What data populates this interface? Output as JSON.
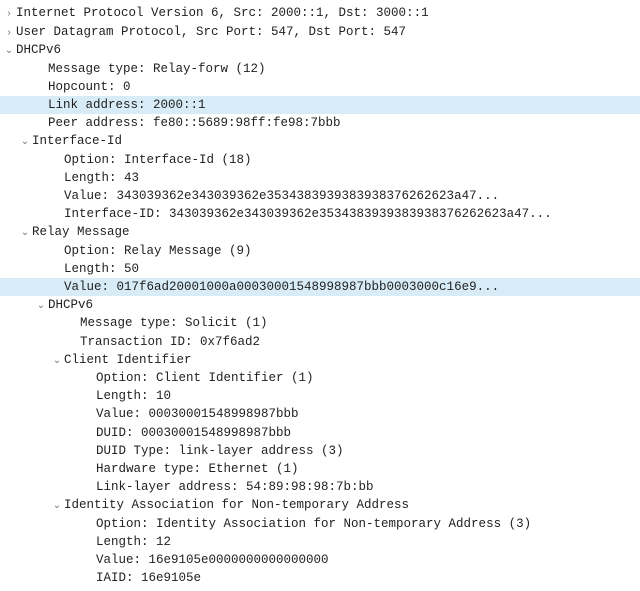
{
  "lines": [
    {
      "indent": 0,
      "caret": "right",
      "hl": false,
      "text": "Internet Protocol Version 6, Src: 2000::1, Dst: 3000::1"
    },
    {
      "indent": 0,
      "caret": "right",
      "hl": false,
      "text": "User Datagram Protocol, Src Port: 547, Dst Port: 547"
    },
    {
      "indent": 0,
      "caret": "down",
      "hl": false,
      "text": "DHCPv6"
    },
    {
      "indent": 2,
      "caret": "none",
      "hl": false,
      "text": "Message type: Relay-forw (12)"
    },
    {
      "indent": 2,
      "caret": "none",
      "hl": false,
      "text": "Hopcount: 0"
    },
    {
      "indent": 2,
      "caret": "none",
      "hl": true,
      "text": "Link address: 2000::1"
    },
    {
      "indent": 2,
      "caret": "none",
      "hl": false,
      "text": "Peer address: fe80::5689:98ff:fe98:7bbb"
    },
    {
      "indent": 1,
      "caret": "down",
      "hl": false,
      "text": "Interface-Id"
    },
    {
      "indent": 3,
      "caret": "none",
      "hl": false,
      "text": "Option: Interface-Id (18)"
    },
    {
      "indent": 3,
      "caret": "none",
      "hl": false,
      "text": "Length: 43"
    },
    {
      "indent": 3,
      "caret": "none",
      "hl": false,
      "text": "Value: 343039362e343039362e3534383939383938376262623a47..."
    },
    {
      "indent": 3,
      "caret": "none",
      "hl": false,
      "text": "Interface-ID: 343039362e343039362e3534383939383938376262623a47..."
    },
    {
      "indent": 1,
      "caret": "down",
      "hl": false,
      "text": "Relay Message"
    },
    {
      "indent": 3,
      "caret": "none",
      "hl": false,
      "text": "Option: Relay Message (9)"
    },
    {
      "indent": 3,
      "caret": "none",
      "hl": false,
      "text": "Length: 50"
    },
    {
      "indent": 3,
      "caret": "none",
      "hl": true,
      "text": "Value: 017f6ad20001000a00030001548998987bbb0003000c16e9..."
    },
    {
      "indent": 2,
      "caret": "down",
      "hl": false,
      "text": "DHCPv6"
    },
    {
      "indent": 4,
      "caret": "none",
      "hl": false,
      "text": "Message type: Solicit (1)"
    },
    {
      "indent": 4,
      "caret": "none",
      "hl": false,
      "text": "Transaction ID: 0x7f6ad2"
    },
    {
      "indent": 3,
      "caret": "down",
      "hl": false,
      "text": "Client Identifier"
    },
    {
      "indent": 5,
      "caret": "none",
      "hl": false,
      "text": "Option: Client Identifier (1)"
    },
    {
      "indent": 5,
      "caret": "none",
      "hl": false,
      "text": "Length: 10"
    },
    {
      "indent": 5,
      "caret": "none",
      "hl": false,
      "text": "Value: 00030001548998987bbb"
    },
    {
      "indent": 5,
      "caret": "none",
      "hl": false,
      "text": "DUID: 00030001548998987bbb"
    },
    {
      "indent": 5,
      "caret": "none",
      "hl": false,
      "text": "DUID Type: link-layer address (3)"
    },
    {
      "indent": 5,
      "caret": "none",
      "hl": false,
      "text": "Hardware type: Ethernet (1)"
    },
    {
      "indent": 5,
      "caret": "none",
      "hl": false,
      "text": "Link-layer address: 54:89:98:98:7b:bb"
    },
    {
      "indent": 3,
      "caret": "down",
      "hl": false,
      "text": "Identity Association for Non-temporary Address"
    },
    {
      "indent": 5,
      "caret": "none",
      "hl": false,
      "text": "Option: Identity Association for Non-temporary Address (3)"
    },
    {
      "indent": 5,
      "caret": "none",
      "hl": false,
      "text": "Length: 12"
    },
    {
      "indent": 5,
      "caret": "none",
      "hl": false,
      "text": "Value: 16e9105e0000000000000000"
    },
    {
      "indent": 5,
      "caret": "none",
      "hl": false,
      "text": "IAID: 16e9105e"
    }
  ],
  "caret_glyphs": {
    "right": "›",
    "down": "⌄",
    "none": " "
  }
}
